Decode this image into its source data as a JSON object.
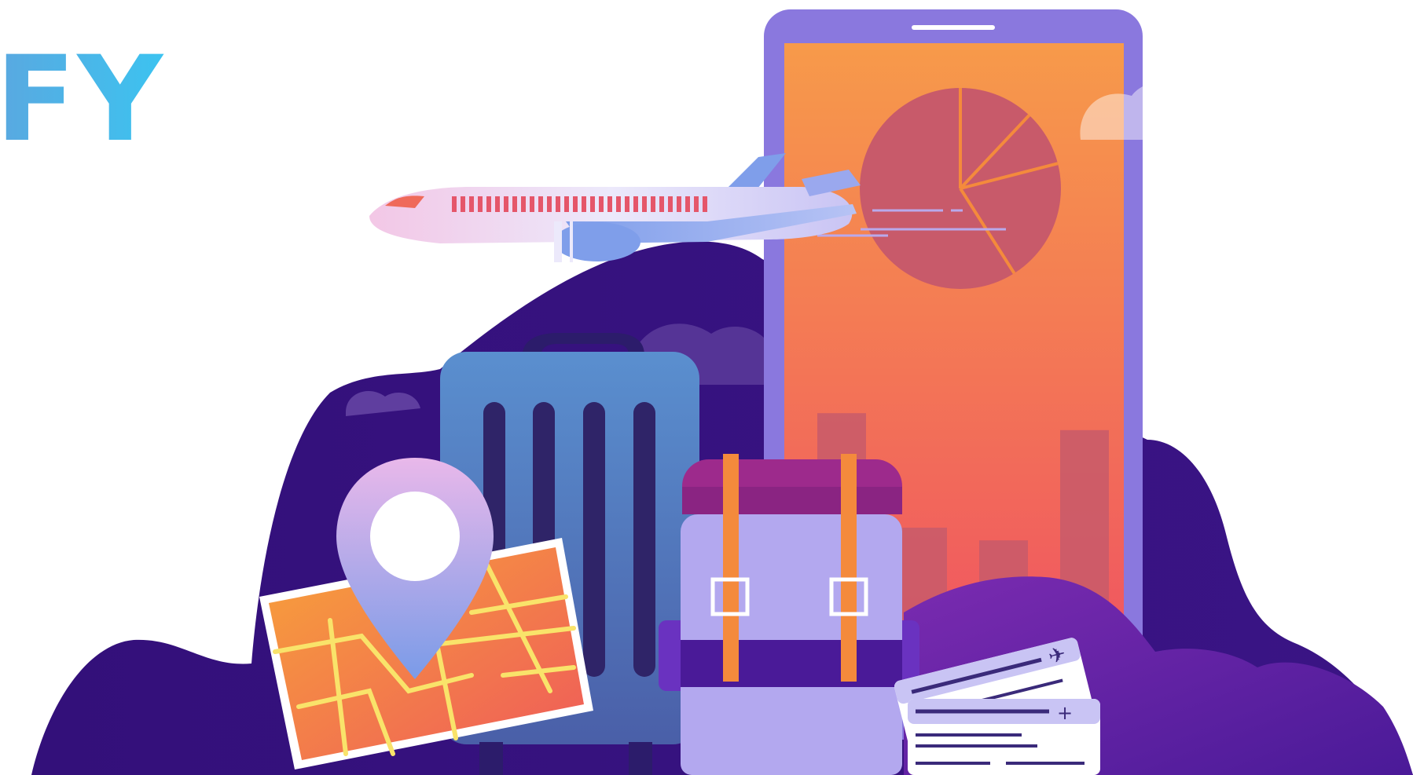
{
  "logo": {
    "text": "FY",
    "color_start": "#5aa8e0",
    "color_end": "#3cc3f0"
  },
  "colors": {
    "background": "#ffffff",
    "hill_dark": "#33107a",
    "hill_mid": "#6a22a8",
    "phone_frame": "#8a78de",
    "phone_screen_top": "#f79a4a",
    "phone_screen_bottom": "#ef4e63",
    "suitcase": "#5b86c8",
    "backpack": "#b3a8ef",
    "map": "#f08a3c",
    "plane_body": "#e8e6f7"
  },
  "illustration": {
    "icons": [
      "airplane-icon",
      "smartphone-icon",
      "pie-chart-icon",
      "bar-chart-icon",
      "suitcase-icon",
      "backpack-icon",
      "map-icon",
      "location-pin-icon",
      "tickets-icon",
      "cloud-icon"
    ],
    "phone_pie_slices": [
      0.12,
      0.09,
      0.2,
      0.59
    ],
    "phone_bars": [
      0.72,
      0.45,
      0.42,
      0.68
    ]
  }
}
